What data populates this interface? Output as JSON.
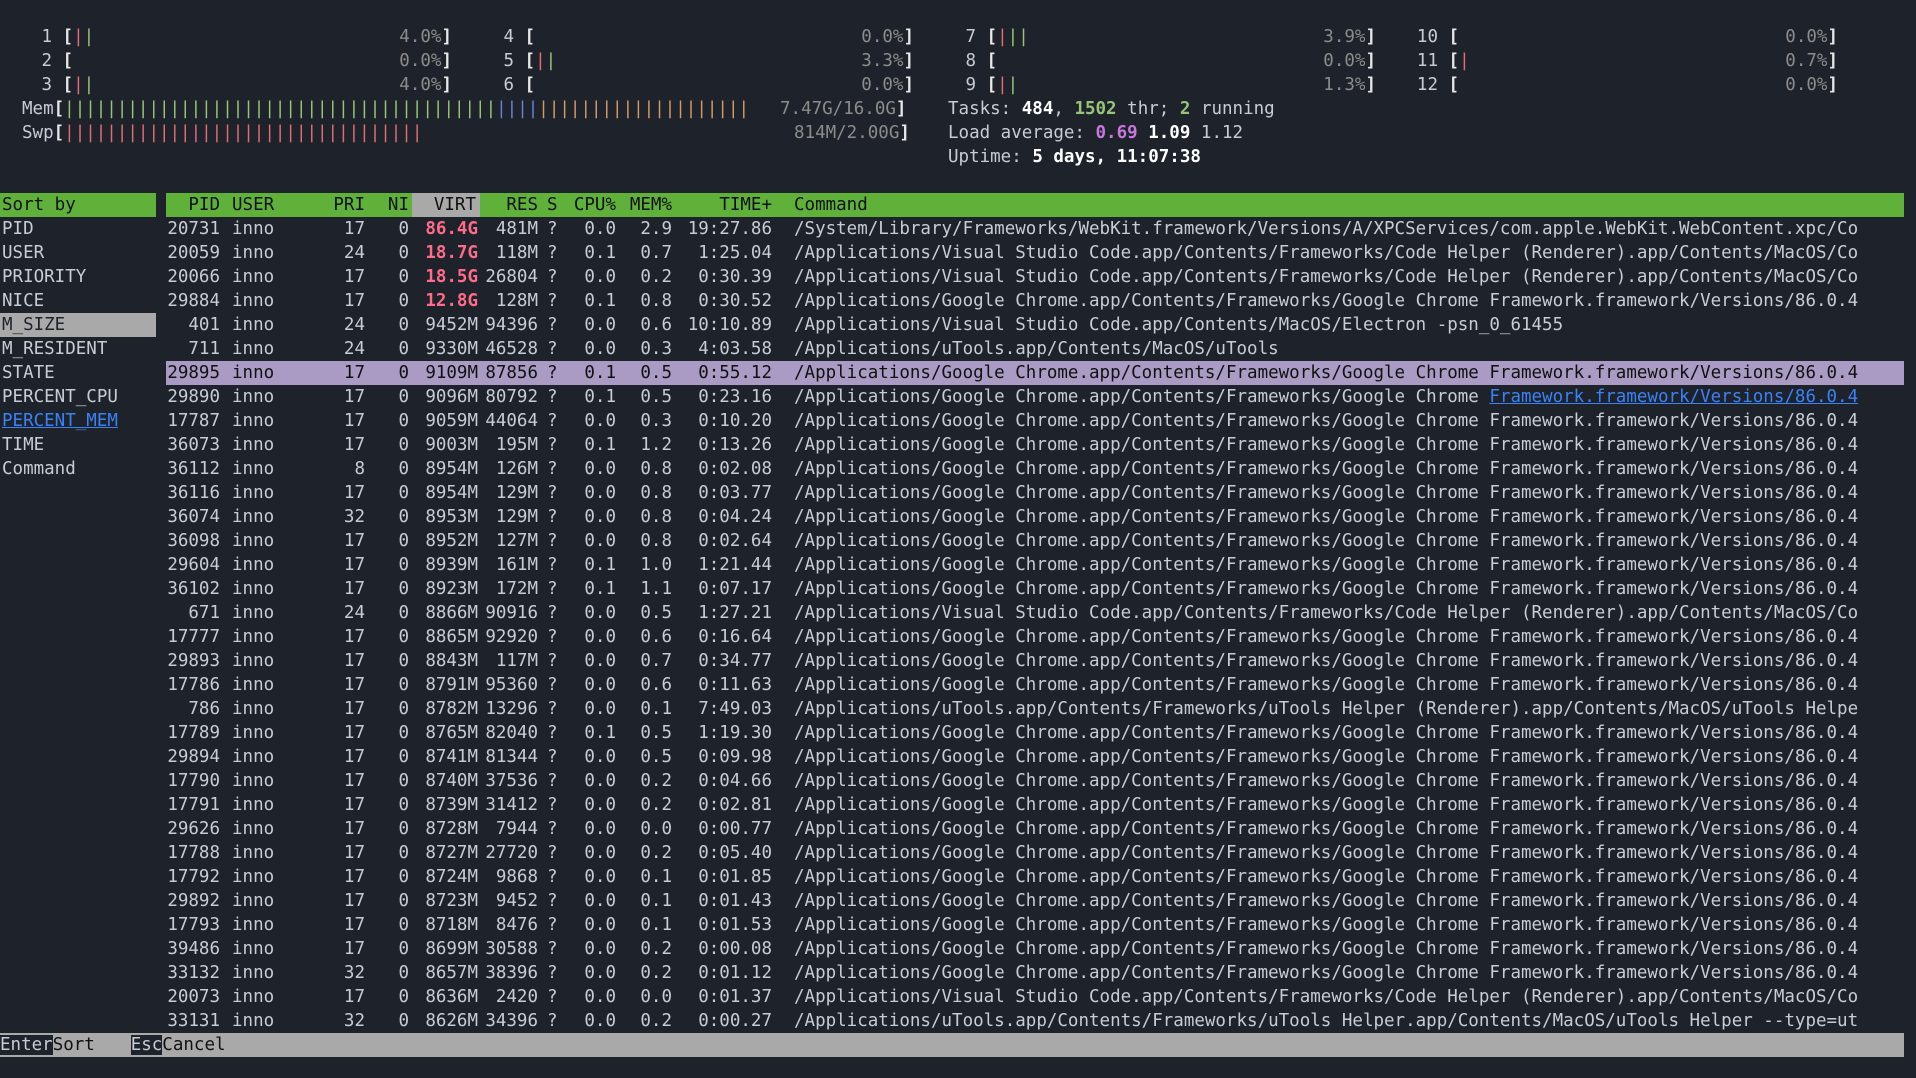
{
  "cpus": [
    {
      "n": "1",
      "bar": "||",
      "pct": "4.0%"
    },
    {
      "n": "2",
      "bar": "",
      "pct": "0.0%"
    },
    {
      "n": "3",
      "bar": "||",
      "pct": "4.0%"
    },
    {
      "n": "4",
      "bar": "",
      "pct": "0.0%"
    },
    {
      "n": "5",
      "bar": "||",
      "pct": "3.3%"
    },
    {
      "n": "6",
      "bar": "",
      "pct": "0.0%"
    },
    {
      "n": "7",
      "bar": "|||",
      "pct": "3.9%"
    },
    {
      "n": "8",
      "bar": "",
      "pct": "0.0%"
    },
    {
      "n": "9",
      "bar": "||",
      "pct": "1.3%"
    },
    {
      "n": "10",
      "bar": "",
      "pct": "0.0%"
    },
    {
      "n": "11",
      "bar": "|",
      "pct": "0.7%"
    },
    {
      "n": "12",
      "bar": "",
      "pct": "0.0%"
    }
  ],
  "mem": {
    "label": "Mem",
    "value": "7.47G/16.0G",
    "green": "|||||||||||||||||||||||||||||||||||||||||",
    "blue": "||||",
    "orange": "||||||||||||||||||||"
  },
  "swp": {
    "label": "Swp",
    "value": "814M/2.00G",
    "red": "||||||||||||||||||||||||||||||||||"
  },
  "tasks": {
    "label": "Tasks:",
    "count": "484",
    "thr": "1502",
    "thr_label": "thr;",
    "running": "2",
    "running_label": "running"
  },
  "load": {
    "label": "Load average:",
    "l1": "0.69",
    "l5": "1.09",
    "l15": "1.12"
  },
  "uptime": {
    "label": "Uptime:",
    "value": "5 days, 11:07:38"
  },
  "sort_panel": {
    "header": "Sort by",
    "items": [
      "PID",
      "USER",
      "PRIORITY",
      "NICE",
      "M_SIZE",
      "M_RESIDENT",
      "STATE",
      "PERCENT_CPU",
      "PERCENT_MEM",
      "TIME",
      "Command"
    ],
    "selected": "M_SIZE",
    "linked": "PERCENT_MEM"
  },
  "columns": [
    "PID",
    "USER",
    "PRI",
    "NI",
    "VIRT",
    "RES",
    "S",
    "CPU%",
    "MEM%",
    "TIME+",
    "Command"
  ],
  "rows": [
    [
      "20731",
      "inno",
      "17",
      "0",
      "86.4G",
      "481M",
      "?",
      "0.0",
      "2.9",
      "19:27.86",
      "/System/Library/Frameworks/WebKit.framework/Versions/A/XPCServices/com.apple.WebKit.WebContent.xpc/Co"
    ],
    [
      "20059",
      "inno",
      "24",
      "0",
      "18.7G",
      "118M",
      "?",
      "0.1",
      "0.7",
      "1:25.04",
      "/Applications/Visual Studio Code.app/Contents/Frameworks/Code Helper (Renderer).app/Contents/MacOS/Co"
    ],
    [
      "20066",
      "inno",
      "17",
      "0",
      "18.5G",
      "26804",
      "?",
      "0.0",
      "0.2",
      "0:30.39",
      "/Applications/Visual Studio Code.app/Contents/Frameworks/Code Helper (Renderer).app/Contents/MacOS/Co"
    ],
    [
      "29884",
      "inno",
      "17",
      "0",
      "12.8G",
      "128M",
      "?",
      "0.1",
      "0.8",
      "0:30.52",
      "/Applications/Google Chrome.app/Contents/Frameworks/Google Chrome Framework.framework/Versions/86.0.4"
    ],
    [
      "401",
      "inno",
      "24",
      "0",
      "9452M",
      "94396",
      "?",
      "0.0",
      "0.6",
      "10:10.89",
      "/Applications/Visual Studio Code.app/Contents/MacOS/Electron -psn_0_61455"
    ],
    [
      "711",
      "inno",
      "24",
      "0",
      "9330M",
      "46528",
      "?",
      "0.0",
      "0.3",
      "4:03.58",
      "/Applications/uTools.app/Contents/MacOS/uTools"
    ],
    [
      "29895",
      "inno",
      "17",
      "0",
      "9109M",
      "87856",
      "?",
      "0.1",
      "0.5",
      "0:55.12",
      "/Applications/Google Chrome.app/Contents/Frameworks/Google Chrome Framework.framework/Versions/86.0.4"
    ],
    [
      "29890",
      "inno",
      "17",
      "0",
      "9096M",
      "80792",
      "?",
      "0.1",
      "0.5",
      "0:23.16",
      "/Applications/Google Chrome.app/Contents/Frameworks/Google Chrome Framework.framework/Versions/86.0.4"
    ],
    [
      "17787",
      "inno",
      "17",
      "0",
      "9059M",
      "44064",
      "?",
      "0.0",
      "0.3",
      "0:10.20",
      "/Applications/Google Chrome.app/Contents/Frameworks/Google Chrome Framework.framework/Versions/86.0.4"
    ],
    [
      "36073",
      "inno",
      "17",
      "0",
      "9003M",
      "195M",
      "?",
      "0.1",
      "1.2",
      "0:13.26",
      "/Applications/Google Chrome.app/Contents/Frameworks/Google Chrome Framework.framework/Versions/86.0.4"
    ],
    [
      "36112",
      "inno",
      "8",
      "0",
      "8954M",
      "126M",
      "?",
      "0.0",
      "0.8",
      "0:02.08",
      "/Applications/Google Chrome.app/Contents/Frameworks/Google Chrome Framework.framework/Versions/86.0.4"
    ],
    [
      "36116",
      "inno",
      "17",
      "0",
      "8954M",
      "129M",
      "?",
      "0.0",
      "0.8",
      "0:03.77",
      "/Applications/Google Chrome.app/Contents/Frameworks/Google Chrome Framework.framework/Versions/86.0.4"
    ],
    [
      "36074",
      "inno",
      "32",
      "0",
      "8953M",
      "129M",
      "?",
      "0.0",
      "0.8",
      "0:04.24",
      "/Applications/Google Chrome.app/Contents/Frameworks/Google Chrome Framework.framework/Versions/86.0.4"
    ],
    [
      "36098",
      "inno",
      "17",
      "0",
      "8952M",
      "127M",
      "?",
      "0.0",
      "0.8",
      "0:02.64",
      "/Applications/Google Chrome.app/Contents/Frameworks/Google Chrome Framework.framework/Versions/86.0.4"
    ],
    [
      "29604",
      "inno",
      "17",
      "0",
      "8939M",
      "161M",
      "?",
      "0.1",
      "1.0",
      "1:21.44",
      "/Applications/Google Chrome.app/Contents/Frameworks/Google Chrome Framework.framework/Versions/86.0.4"
    ],
    [
      "36102",
      "inno",
      "17",
      "0",
      "8923M",
      "172M",
      "?",
      "0.1",
      "1.1",
      "0:07.17",
      "/Applications/Google Chrome.app/Contents/Frameworks/Google Chrome Framework.framework/Versions/86.0.4"
    ],
    [
      "671",
      "inno",
      "24",
      "0",
      "8866M",
      "90916",
      "?",
      "0.0",
      "0.5",
      "1:27.21",
      "/Applications/Visual Studio Code.app/Contents/Frameworks/Code Helper (Renderer).app/Contents/MacOS/Co"
    ],
    [
      "17777",
      "inno",
      "17",
      "0",
      "8865M",
      "92920",
      "?",
      "0.0",
      "0.6",
      "0:16.64",
      "/Applications/Google Chrome.app/Contents/Frameworks/Google Chrome Framework.framework/Versions/86.0.4"
    ],
    [
      "29893",
      "inno",
      "17",
      "0",
      "8843M",
      "117M",
      "?",
      "0.0",
      "0.7",
      "0:34.77",
      "/Applications/Google Chrome.app/Contents/Frameworks/Google Chrome Framework.framework/Versions/86.0.4"
    ],
    [
      "17786",
      "inno",
      "17",
      "0",
      "8791M",
      "95360",
      "?",
      "0.0",
      "0.6",
      "0:11.63",
      "/Applications/Google Chrome.app/Contents/Frameworks/Google Chrome Framework.framework/Versions/86.0.4"
    ],
    [
      "786",
      "inno",
      "17",
      "0",
      "8782M",
      "13296",
      "?",
      "0.0",
      "0.1",
      "7:49.03",
      "/Applications/uTools.app/Contents/Frameworks/uTools Helper (Renderer).app/Contents/MacOS/uTools Helpe"
    ],
    [
      "17789",
      "inno",
      "17",
      "0",
      "8765M",
      "82040",
      "?",
      "0.1",
      "0.5",
      "1:19.30",
      "/Applications/Google Chrome.app/Contents/Frameworks/Google Chrome Framework.framework/Versions/86.0.4"
    ],
    [
      "29894",
      "inno",
      "17",
      "0",
      "8741M",
      "81344",
      "?",
      "0.0",
      "0.5",
      "0:09.98",
      "/Applications/Google Chrome.app/Contents/Frameworks/Google Chrome Framework.framework/Versions/86.0.4"
    ],
    [
      "17790",
      "inno",
      "17",
      "0",
      "8740M",
      "37536",
      "?",
      "0.0",
      "0.2",
      "0:04.66",
      "/Applications/Google Chrome.app/Contents/Frameworks/Google Chrome Framework.framework/Versions/86.0.4"
    ],
    [
      "17791",
      "inno",
      "17",
      "0",
      "8739M",
      "31412",
      "?",
      "0.0",
      "0.2",
      "0:02.81",
      "/Applications/Google Chrome.app/Contents/Frameworks/Google Chrome Framework.framework/Versions/86.0.4"
    ],
    [
      "29626",
      "inno",
      "17",
      "0",
      "8728M",
      "7944",
      "?",
      "0.0",
      "0.0",
      "0:00.77",
      "/Applications/Google Chrome.app/Contents/Frameworks/Google Chrome Framework.framework/Versions/86.0.4"
    ],
    [
      "17788",
      "inno",
      "17",
      "0",
      "8727M",
      "27720",
      "?",
      "0.0",
      "0.2",
      "0:05.40",
      "/Applications/Google Chrome.app/Contents/Frameworks/Google Chrome Framework.framework/Versions/86.0.4"
    ],
    [
      "17792",
      "inno",
      "17",
      "0",
      "8724M",
      "9868",
      "?",
      "0.0",
      "0.1",
      "0:01.85",
      "/Applications/Google Chrome.app/Contents/Frameworks/Google Chrome Framework.framework/Versions/86.0.4"
    ],
    [
      "29892",
      "inno",
      "17",
      "0",
      "8723M",
      "9452",
      "?",
      "0.0",
      "0.1",
      "0:01.43",
      "/Applications/Google Chrome.app/Contents/Frameworks/Google Chrome Framework.framework/Versions/86.0.4"
    ],
    [
      "17793",
      "inno",
      "17",
      "0",
      "8718M",
      "8476",
      "?",
      "0.0",
      "0.1",
      "0:01.53",
      "/Applications/Google Chrome.app/Contents/Frameworks/Google Chrome Framework.framework/Versions/86.0.4"
    ],
    [
      "39486",
      "inno",
      "17",
      "0",
      "8699M",
      "30588",
      "?",
      "0.0",
      "0.2",
      "0:00.08",
      "/Applications/Google Chrome.app/Contents/Frameworks/Google Chrome Framework.framework/Versions/86.0.4"
    ],
    [
      "33132",
      "inno",
      "32",
      "0",
      "8657M",
      "38396",
      "?",
      "0.0",
      "0.2",
      "0:01.12",
      "/Applications/Google Chrome.app/Contents/Frameworks/Google Chrome Framework.framework/Versions/86.0.4"
    ],
    [
      "20073",
      "inno",
      "17",
      "0",
      "8636M",
      "2420",
      "?",
      "0.0",
      "0.0",
      "0:01.37",
      "/Applications/Visual Studio Code.app/Contents/Frameworks/Code Helper (Renderer).app/Contents/MacOS/Co"
    ],
    [
      "33131",
      "inno",
      "32",
      "0",
      "8626M",
      "34396",
      "?",
      "0.0",
      "0.2",
      "0:00.27",
      "/Applications/uTools.app/Contents/Frameworks/uTools Helper.app/Contents/MacOS/uTools Helper --type=ut"
    ]
  ],
  "selected_row": "29895",
  "footer": {
    "k1": "Enter",
    "a1": "Sort",
    "k2": "Esc",
    "a2": "Cancel"
  },
  "colors": {
    "header_green": "#5fb13a",
    "selection": "#a99bc4",
    "background": "#1e222a"
  }
}
